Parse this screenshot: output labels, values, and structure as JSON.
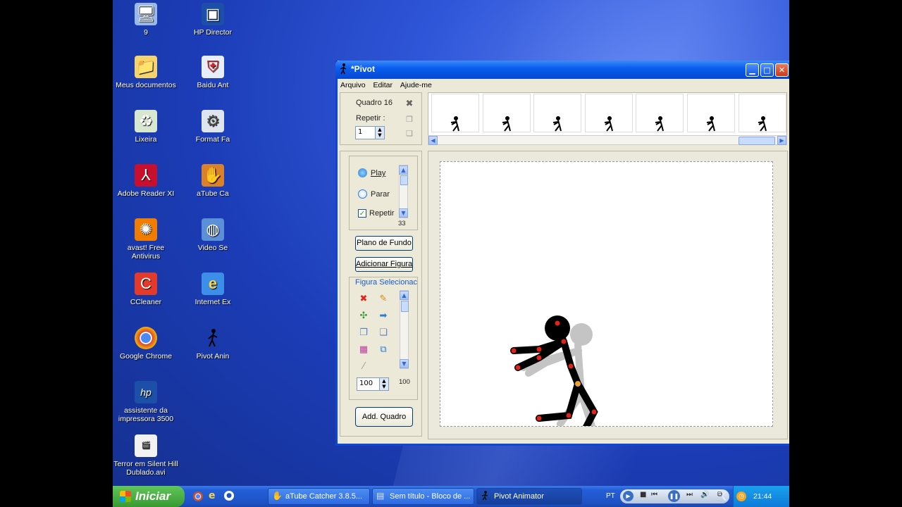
{
  "desktop": {
    "icons": [
      {
        "label": "9",
        "glyph": "computer-icon"
      },
      {
        "label": "HP Director",
        "glyph": "hp-director-icon"
      },
      {
        "label": "Meus documentos",
        "glyph": "folder-icon"
      },
      {
        "label": "Baidu Ant",
        "glyph": "shield-icon"
      },
      {
        "label": "Lixeira",
        "glyph": "recycle-bin-icon"
      },
      {
        "label": "Format Fa",
        "glyph": "format-factory-icon"
      },
      {
        "label": "Adobe Reader XI",
        "glyph": "pdf-icon"
      },
      {
        "label": "aTube Ca",
        "glyph": "baseball-glove-icon"
      },
      {
        "label": "avast! Free Antivirus",
        "glyph": "avast-icon"
      },
      {
        "label": "Video Se",
        "glyph": "globe-icon"
      },
      {
        "label": "CCleaner",
        "glyph": "ccleaner-icon"
      },
      {
        "label": "Internet Ex",
        "glyph": "ie-icon"
      },
      {
        "label": "Google Chrome",
        "glyph": "chrome-icon"
      },
      {
        "label": "Pivot Anin",
        "glyph": "stickman-icon"
      },
      {
        "label": "assistente da impressora 3500",
        "glyph": "hp-icon"
      },
      {
        "label": "Terror em Silent Hill Dublado.avi",
        "glyph": "avi-file-icon"
      }
    ]
  },
  "window": {
    "title": "*Pivot",
    "menu": [
      "Arquivo",
      "Editar",
      "Ajude-me"
    ],
    "frame_panel": {
      "frame_label": "Quadro 16",
      "repeat_label": "Repetir :",
      "repeat_value": "1"
    },
    "timeline": {
      "frame_count": 7
    },
    "playback": {
      "play": "Play",
      "stop": "Parar",
      "repeat": "Repetir",
      "repeat_checked": true,
      "speed": "33"
    },
    "buttons": {
      "background": "Plano de Fundo",
      "add_figure": "Adicionar Figura",
      "add_frame": "Add. Quadro"
    },
    "selected_figure": {
      "title": "Figura Selecionac",
      "scale_value": "100",
      "slider_value": "100"
    },
    "canvas": {
      "accent_color": "#e0231b",
      "joint_color": "#e0231b",
      "center_joint_color": "#f0a030"
    }
  },
  "taskbar": {
    "start_label": "Iniciar",
    "tasks": [
      {
        "label": "aTube Catcher 3.8.5...",
        "icon": "baseball-glove-icon"
      },
      {
        "label": "Sem título - Bloco de ...",
        "icon": "notepad-icon"
      },
      {
        "label": "Pivot Animator",
        "icon": "stickman-icon"
      }
    ],
    "language": "PT",
    "clock": "21:44"
  }
}
